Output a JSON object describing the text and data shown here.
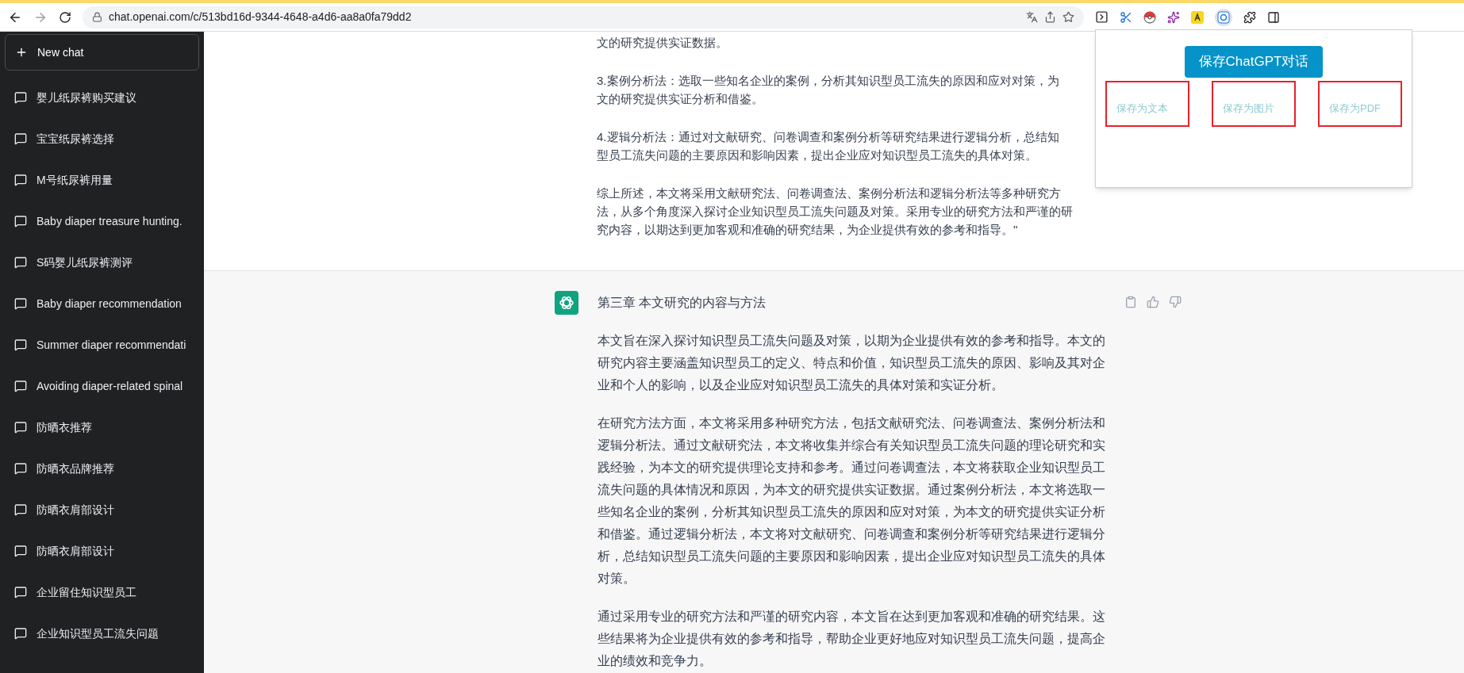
{
  "browser": {
    "url": "chat.openai.com/c/513bd16d-9344-4648-a4d6-aa8a0fa79dd2"
  },
  "sidebar": {
    "new_chat": "New chat",
    "items": [
      {
        "label": "婴儿纸尿裤购买建议"
      },
      {
        "label": "宝宝纸尿裤选择"
      },
      {
        "label": "M号纸尿裤用量"
      },
      {
        "label": "Baby diaper treasure hunting."
      },
      {
        "label": "S码婴儿纸尿裤测评"
      },
      {
        "label": "Baby diaper recommendation"
      },
      {
        "label": "Summer diaper recommendati"
      },
      {
        "label": "Avoiding diaper-related spinal"
      },
      {
        "label": "防晒衣推荐"
      },
      {
        "label": "防晒衣品牌推荐"
      },
      {
        "label": "防晒衣肩部设计"
      },
      {
        "label": "防晒衣肩部设计"
      },
      {
        "label": "企业留住知识型员工"
      },
      {
        "label": "企业知识型员工流失问题"
      }
    ]
  },
  "messages": [
    {
      "kind": "user",
      "paragraphs": [
        [
          "文的研究提供实证数据。"
        ],
        [
          "3.案例分析法：选取一些知名企业的案例，分析其知识型员工流失的原因和应对对策，为",
          "文的研究提供实证分析和借鉴。"
        ],
        [
          "4.逻辑分析法：通过对文献研究、问卷调查和案例分析等研究结果进行逻辑分析，总结知",
          "型员工流失问题的主要原因和影响因素，提出企业应对知识型员工流失的具体对策。"
        ],
        [
          "综上所述，本文将采用文献研究法、问卷调查法、案例分析法和逻辑分析法等多种研究方",
          "法，从多个角度深入探讨企业知识型员工流失问题及对策。采用专业的研究方法和严谨的研",
          "究内容，以期达到更加客观和准确的研究结果，为企业提供有效的参考和指导。\""
        ]
      ]
    },
    {
      "kind": "assistant",
      "title": "第三章 本文研究的内容与方法",
      "paragraphs": [
        [
          "本文旨在深入探讨知识型员工流失问题及对策，以期为企业提供有效的参考和指导。本文的研究内容主要涵盖知识型员工的定义、特点和价值，知识型员工流失的原因、影响及其对企业和个人的影响，以及企业应对知识型员工流失的具体对策和实证分析。"
        ],
        [
          "在研究方法方面，本文将采用多种研究方法，包括文献研究法、问卷调查法、案例分析法和逻辑分析法。通过文献研究法，本文将收集并综合有关知识型员工流失问题的理论研究和实践经验，为本文的研究提供理论支持和参考。通过问卷调查法，本文将获取企业知识型员工流失问题的具体情况和原因，为本文的研究提供实证数据。通过案例分析法，本文将选取一些知名企业的案例，分析其知识型员工流失的原因和应对对策，为本文的研究提供实证分析和借鉴。通过逻辑分析法，本文将对文献研究、问卷调查和案例分析等研究结果进行逻辑分析，总结知识型员工流失问题的主要原因和影响因素，提出企业应对知识型员工流失的具体对策。"
        ],
        [
          "通过采用专业的研究方法和严谨的研究内容，本文旨在达到更加客观和准确的研究结果。这些结果将为企业提供有效的参考和指导，帮助企业更好地应对知识型员工流失问题，提高企业的绩效和竞争力。"
        ]
      ]
    }
  ],
  "popup": {
    "button": "保存ChatGPT对话",
    "options": [
      "保存为文本",
      "保存为图片",
      "保存为PDF"
    ]
  }
}
